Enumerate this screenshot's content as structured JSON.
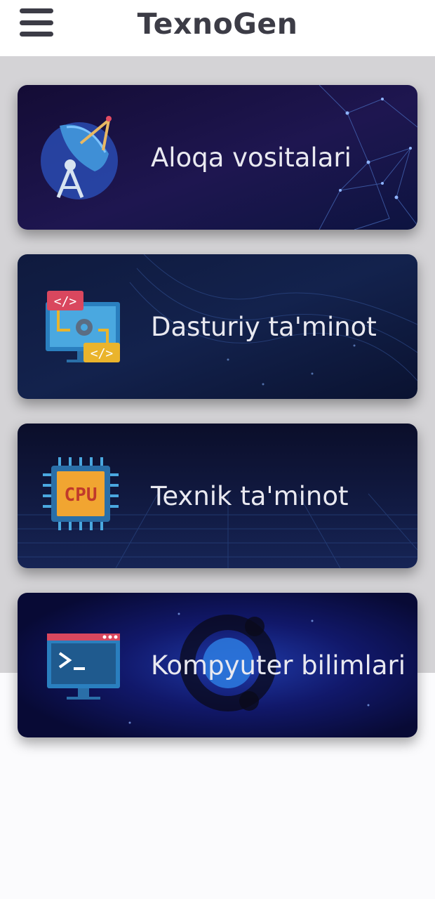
{
  "header": {
    "title": "TexnoGen",
    "menu_icon": "hamburger-menu-icon"
  },
  "cards": [
    {
      "label": "Aloqa vositalari",
      "icon": "satellite-dish-icon"
    },
    {
      "label": "Dasturiy ta'minot",
      "icon": "code-monitor-icon"
    },
    {
      "label": "Texnik ta'minot",
      "icon": "cpu-chip-icon",
      "icon_text": "CPU"
    },
    {
      "label": "Kompyuter bilimlari",
      "icon": "terminal-monitor-icon"
    }
  ],
  "colors": {
    "header_bg": "#ffffff",
    "title": "#3c3c46",
    "page_bg": "#d4d3d6",
    "card_label": "#e9e9f0"
  }
}
